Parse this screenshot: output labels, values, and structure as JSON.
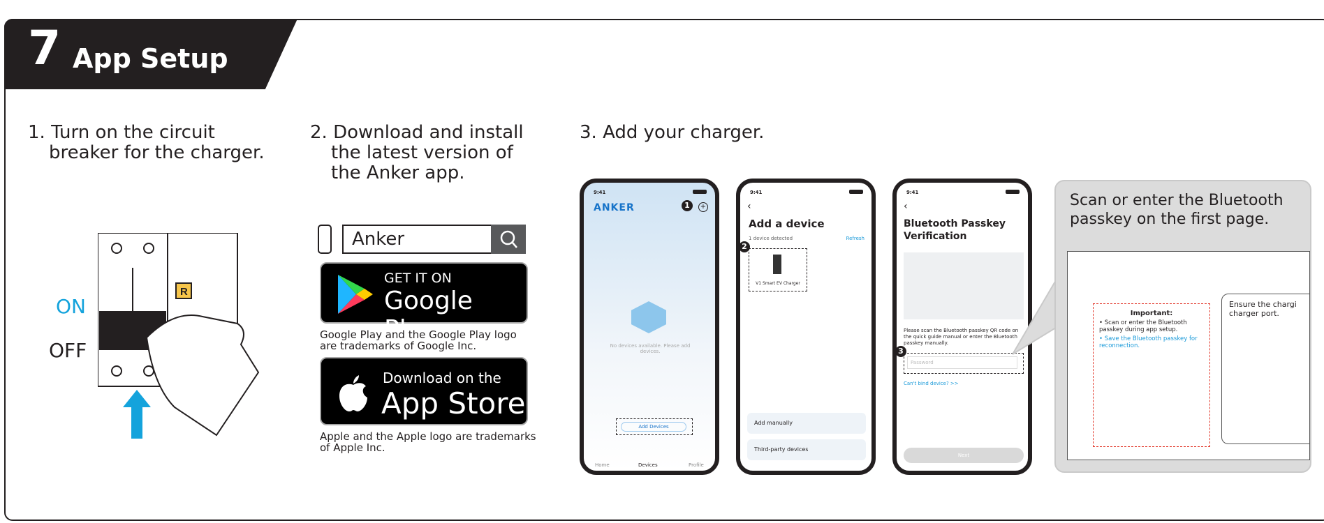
{
  "header": {
    "step_number": "7",
    "title": "App Setup"
  },
  "step1": {
    "line1": "1. Turn on the circuit",
    "line2": "breaker for the charger.",
    "on_label": "ON",
    "off_label": "OFF",
    "badge": "R"
  },
  "step2": {
    "line1": "2. Download and install",
    "line2": "the latest version of",
    "line3": "the Anker app.",
    "search_value": "Anker",
    "google_small": "GET IT ON",
    "google_big": "Google Play",
    "google_note": "Google Play and the Google Play logo are trademarks of Google Inc.",
    "apple_small": "Download on the",
    "apple_big": "App Store",
    "apple_note": "Apple and the Apple logo are trademarks of Apple Inc."
  },
  "step3": {
    "title": "3. Add your charger.",
    "phone1": {
      "time": "9:41",
      "logo": "ANKER",
      "num": "1",
      "empty": "No devices available. Please add devices.",
      "add_button": "Add Devices",
      "tabs": [
        "Home",
        "Devices",
        "Profile"
      ]
    },
    "phone2": {
      "time": "9:41",
      "title": "Add a device",
      "detected": "1 device detected",
      "refresh": "Refresh",
      "num": "2",
      "device": "V1 Smart EV Charger",
      "options": [
        "Add manually",
        "Third-party devices"
      ]
    },
    "phone3": {
      "time": "9:41",
      "title": "Bluetooth Passkey Verification",
      "desc": "Please scan the Bluetooth passkey QR code on the quick guide manual or enter the Bluetooth passkey manually.",
      "num": "3",
      "placeholder": "Password",
      "link": "Can't bind device? >>",
      "next": "Next"
    },
    "callout": {
      "heading": "Scan or enter the Bluetooth passkey on the first page.",
      "important": "Important:",
      "line1": "• Scan or enter the Bluetooth passkey during app setup.",
      "line2": "• Save the Bluetooth passkey for reconnection.",
      "ensure": "Ensure the chargi charger port."
    }
  },
  "colors": {
    "accent": "#14a3dc",
    "dark": "#231f20"
  }
}
